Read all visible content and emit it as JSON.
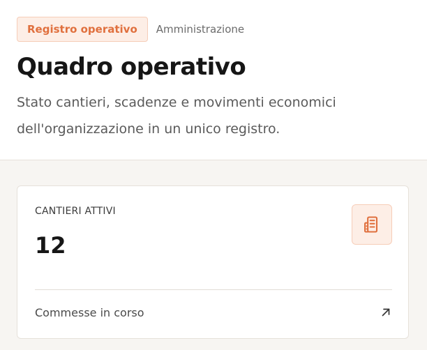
{
  "breadcrumb": {
    "active": "Registro operativo",
    "link": "Amministrazione"
  },
  "page": {
    "title": "Quadro operativo",
    "subtitle": "Stato cantieri, scadenze e movimenti economici dell'organizzazione in un unico registro."
  },
  "stat_card": {
    "label": "CANTIERI ATTIVI",
    "value": "12",
    "icon": "building-icon",
    "footer_label": "Commesse in corso",
    "footer_icon": "arrow-up-right-icon"
  },
  "colors": {
    "accent": "#e0703e",
    "accent_bg": "#fdeee6",
    "page_bg": "#f7f5f2"
  }
}
